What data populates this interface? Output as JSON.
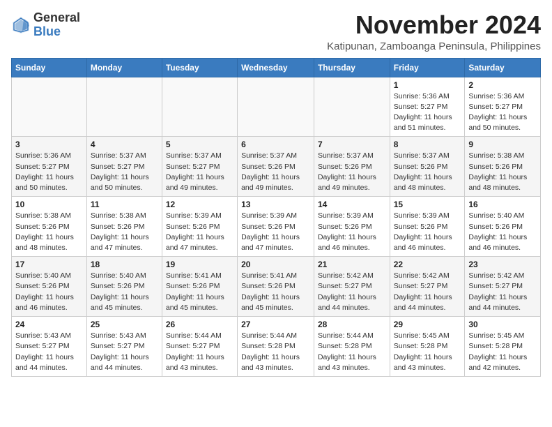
{
  "header": {
    "logo_general": "General",
    "logo_blue": "Blue",
    "month_title": "November 2024",
    "subtitle": "Katipunan, Zamboanga Peninsula, Philippines"
  },
  "weekdays": [
    "Sunday",
    "Monday",
    "Tuesday",
    "Wednesday",
    "Thursday",
    "Friday",
    "Saturday"
  ],
  "weeks": [
    [
      {
        "day": "",
        "info": ""
      },
      {
        "day": "",
        "info": ""
      },
      {
        "day": "",
        "info": ""
      },
      {
        "day": "",
        "info": ""
      },
      {
        "day": "",
        "info": ""
      },
      {
        "day": "1",
        "info": "Sunrise: 5:36 AM\nSunset: 5:27 PM\nDaylight: 11 hours\nand 51 minutes."
      },
      {
        "day": "2",
        "info": "Sunrise: 5:36 AM\nSunset: 5:27 PM\nDaylight: 11 hours\nand 50 minutes."
      }
    ],
    [
      {
        "day": "3",
        "info": "Sunrise: 5:36 AM\nSunset: 5:27 PM\nDaylight: 11 hours\nand 50 minutes."
      },
      {
        "day": "4",
        "info": "Sunrise: 5:37 AM\nSunset: 5:27 PM\nDaylight: 11 hours\nand 50 minutes."
      },
      {
        "day": "5",
        "info": "Sunrise: 5:37 AM\nSunset: 5:27 PM\nDaylight: 11 hours\nand 49 minutes."
      },
      {
        "day": "6",
        "info": "Sunrise: 5:37 AM\nSunset: 5:26 PM\nDaylight: 11 hours\nand 49 minutes."
      },
      {
        "day": "7",
        "info": "Sunrise: 5:37 AM\nSunset: 5:26 PM\nDaylight: 11 hours\nand 49 minutes."
      },
      {
        "day": "8",
        "info": "Sunrise: 5:37 AM\nSunset: 5:26 PM\nDaylight: 11 hours\nand 48 minutes."
      },
      {
        "day": "9",
        "info": "Sunrise: 5:38 AM\nSunset: 5:26 PM\nDaylight: 11 hours\nand 48 minutes."
      }
    ],
    [
      {
        "day": "10",
        "info": "Sunrise: 5:38 AM\nSunset: 5:26 PM\nDaylight: 11 hours\nand 48 minutes."
      },
      {
        "day": "11",
        "info": "Sunrise: 5:38 AM\nSunset: 5:26 PM\nDaylight: 11 hours\nand 47 minutes."
      },
      {
        "day": "12",
        "info": "Sunrise: 5:39 AM\nSunset: 5:26 PM\nDaylight: 11 hours\nand 47 minutes."
      },
      {
        "day": "13",
        "info": "Sunrise: 5:39 AM\nSunset: 5:26 PM\nDaylight: 11 hours\nand 47 minutes."
      },
      {
        "day": "14",
        "info": "Sunrise: 5:39 AM\nSunset: 5:26 PM\nDaylight: 11 hours\nand 46 minutes."
      },
      {
        "day": "15",
        "info": "Sunrise: 5:39 AM\nSunset: 5:26 PM\nDaylight: 11 hours\nand 46 minutes."
      },
      {
        "day": "16",
        "info": "Sunrise: 5:40 AM\nSunset: 5:26 PM\nDaylight: 11 hours\nand 46 minutes."
      }
    ],
    [
      {
        "day": "17",
        "info": "Sunrise: 5:40 AM\nSunset: 5:26 PM\nDaylight: 11 hours\nand 46 minutes."
      },
      {
        "day": "18",
        "info": "Sunrise: 5:40 AM\nSunset: 5:26 PM\nDaylight: 11 hours\nand 45 minutes."
      },
      {
        "day": "19",
        "info": "Sunrise: 5:41 AM\nSunset: 5:26 PM\nDaylight: 11 hours\nand 45 minutes."
      },
      {
        "day": "20",
        "info": "Sunrise: 5:41 AM\nSunset: 5:26 PM\nDaylight: 11 hours\nand 45 minutes."
      },
      {
        "day": "21",
        "info": "Sunrise: 5:42 AM\nSunset: 5:27 PM\nDaylight: 11 hours\nand 44 minutes."
      },
      {
        "day": "22",
        "info": "Sunrise: 5:42 AM\nSunset: 5:27 PM\nDaylight: 11 hours\nand 44 minutes."
      },
      {
        "day": "23",
        "info": "Sunrise: 5:42 AM\nSunset: 5:27 PM\nDaylight: 11 hours\nand 44 minutes."
      }
    ],
    [
      {
        "day": "24",
        "info": "Sunrise: 5:43 AM\nSunset: 5:27 PM\nDaylight: 11 hours\nand 44 minutes."
      },
      {
        "day": "25",
        "info": "Sunrise: 5:43 AM\nSunset: 5:27 PM\nDaylight: 11 hours\nand 44 minutes."
      },
      {
        "day": "26",
        "info": "Sunrise: 5:44 AM\nSunset: 5:27 PM\nDaylight: 11 hours\nand 43 minutes."
      },
      {
        "day": "27",
        "info": "Sunrise: 5:44 AM\nSunset: 5:28 PM\nDaylight: 11 hours\nand 43 minutes."
      },
      {
        "day": "28",
        "info": "Sunrise: 5:44 AM\nSunset: 5:28 PM\nDaylight: 11 hours\nand 43 minutes."
      },
      {
        "day": "29",
        "info": "Sunrise: 5:45 AM\nSunset: 5:28 PM\nDaylight: 11 hours\nand 43 minutes."
      },
      {
        "day": "30",
        "info": "Sunrise: 5:45 AM\nSunset: 5:28 PM\nDaylight: 11 hours\nand 42 minutes."
      }
    ]
  ]
}
